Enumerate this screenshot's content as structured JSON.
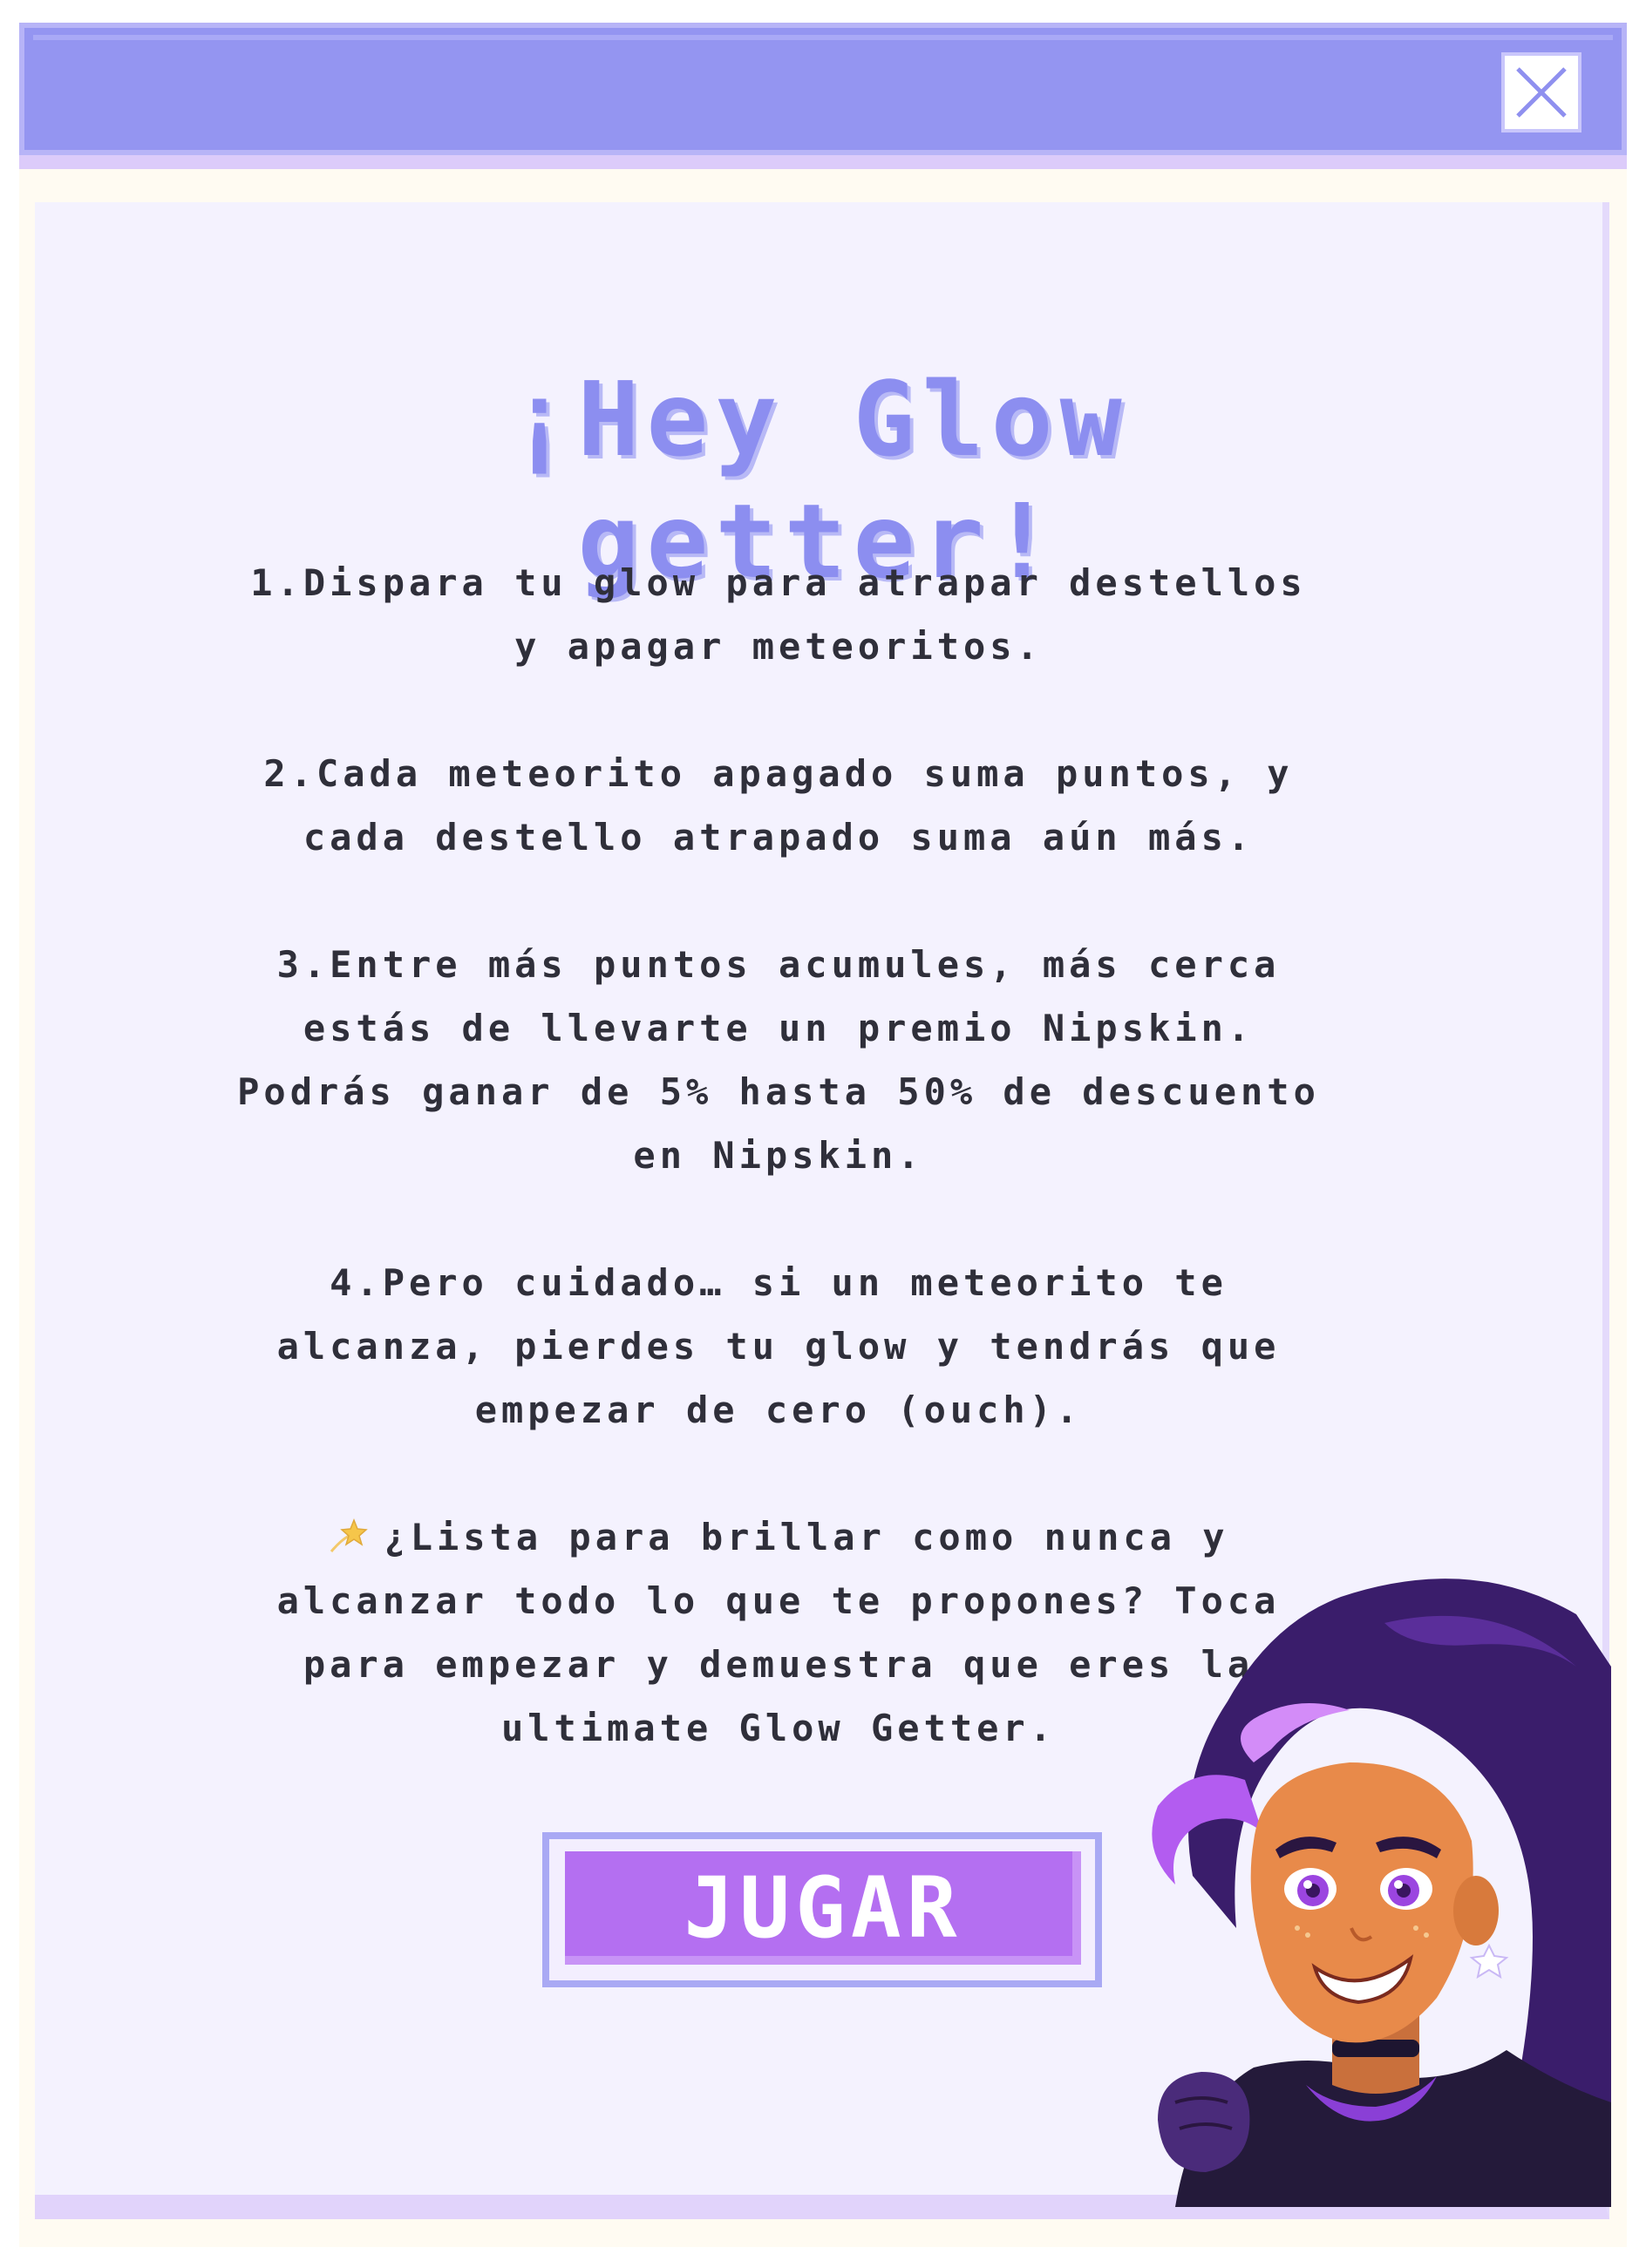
{
  "window": {
    "close_label": "close"
  },
  "title": {
    "line1": "¡Hey Glow",
    "line2": "getter!"
  },
  "instructions": [
    {
      "lines": [
        "1.Dispara tu glow para atrapar destellos",
        "y apagar meteoritos."
      ]
    },
    {
      "lines": [
        "2.Cada meteorito apagado suma puntos, y",
        "cada destello atrapado suma aún más."
      ]
    },
    {
      "lines": [
        "3.Entre más puntos acumules, más cerca",
        "estás de llevarte un premio Nipskin.",
        "Podrás ganar de 5% hasta 50% de descuento",
        "en Nipskin."
      ]
    },
    {
      "lines": [
        "4.Pero cuidado… si un meteorito te",
        "alcanza, pierdes tu glow y tendrás que",
        "empezar de cero (ouch)."
      ]
    },
    {
      "lines": [
        "¿Lista para brillar como nunca y",
        "alcanzar todo lo que te propones? Toca",
        "para empezar y demuestra que eres la",
        "ultimate Glow Getter."
      ]
    }
  ],
  "play_button": {
    "label": "JUGAR"
  },
  "icons": {
    "close": "close-icon",
    "star": "shooting-star-icon",
    "character": "character-illustration"
  },
  "colors": {
    "titlebar": "#9495f1",
    "title_text": "#8c8ef0",
    "button": "#b46ff1",
    "content_bg": "#f4f2fe"
  }
}
